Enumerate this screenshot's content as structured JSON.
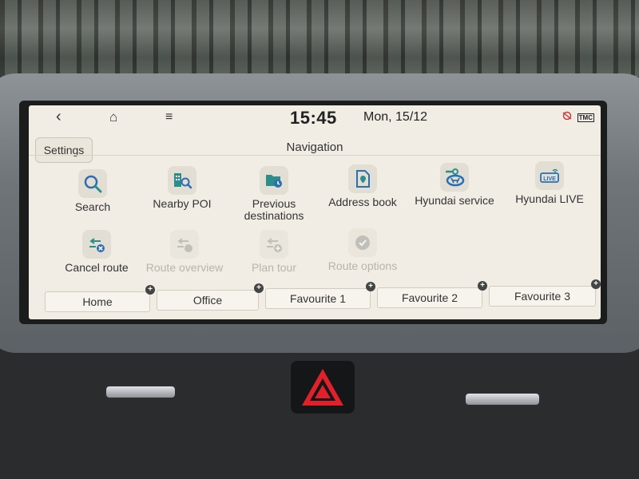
{
  "status_bar": {
    "back_icon": "‹",
    "home_icon": "⌂",
    "menu_icon": "≡",
    "time": "15:45",
    "date": "Mon, 15/12",
    "tmc": "TMC"
  },
  "header": {
    "settings_label": "Settings",
    "title": "Navigation"
  },
  "menu": {
    "row1": [
      {
        "label": "Search",
        "icon": "search-icon"
      },
      {
        "label": "Nearby POI",
        "icon": "nearby-poi-icon"
      },
      {
        "label": "Previous destinations",
        "icon": "previous-destinations-icon"
      },
      {
        "label": "Address book",
        "icon": "address-book-icon"
      },
      {
        "label": "Hyundai service",
        "icon": "hyundai-service-icon"
      },
      {
        "label": "Hyundai LIVE",
        "icon": "hyundai-live-icon"
      }
    ],
    "row2": [
      {
        "label": "Cancel route",
        "icon": "cancel-route-icon",
        "enabled": true
      },
      {
        "label": "Route overview",
        "icon": "route-overview-icon",
        "enabled": false
      },
      {
        "label": "Plan tour",
        "icon": "plan-tour-icon",
        "enabled": false
      },
      {
        "label": "Route options",
        "icon": "route-options-icon",
        "enabled": false
      }
    ]
  },
  "favourites": [
    {
      "label": "Home"
    },
    {
      "label": "Office"
    },
    {
      "label": "Favourite 1"
    },
    {
      "label": "Favourite 2"
    },
    {
      "label": "Favourite 3"
    }
  ],
  "live_badge": "LIVE",
  "colors": {
    "accent_teal": "#2a8f8c",
    "accent_blue": "#2b6fb3",
    "screen_bg": "#f1ede5",
    "hazard_red": "#e0202a"
  }
}
